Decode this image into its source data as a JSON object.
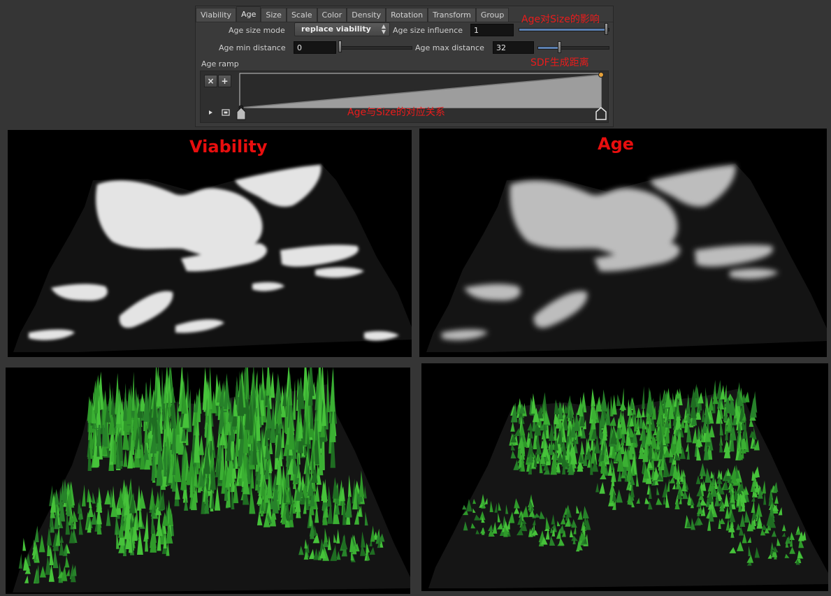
{
  "tabs": [
    "Viability",
    "Age",
    "Size",
    "Scale",
    "Color",
    "Density",
    "Rotation",
    "Transform",
    "Group"
  ],
  "active_tab": "Age",
  "age_size_mode": {
    "label": "Age size mode",
    "value": "replace viability"
  },
  "age_size_influence": {
    "label": "Age size influence",
    "value": "1",
    "slider_fraction": 1.0
  },
  "age_min_distance": {
    "label": "Age min distance",
    "value": "0",
    "slider_fraction": 0.0
  },
  "age_max_distance": {
    "label": "Age max distance",
    "value": "32",
    "slider_fraction": 0.3
  },
  "age_ramp": {
    "label": "Age ramp",
    "delete_icon": "×",
    "add_icon": "+"
  },
  "annotations": {
    "influence": "Age对Size的影响",
    "sdf": "SDF生成距离",
    "ramp": "Age与Size的对应关系"
  },
  "viewports": {
    "viability_title": "Viability",
    "age_title": "Age"
  },
  "colors": {
    "annotation": "#e81c1c",
    "slider_fill": "#5b7fb0",
    "ramp_point": "#e8a23a",
    "grass": "#2f9a2a"
  }
}
